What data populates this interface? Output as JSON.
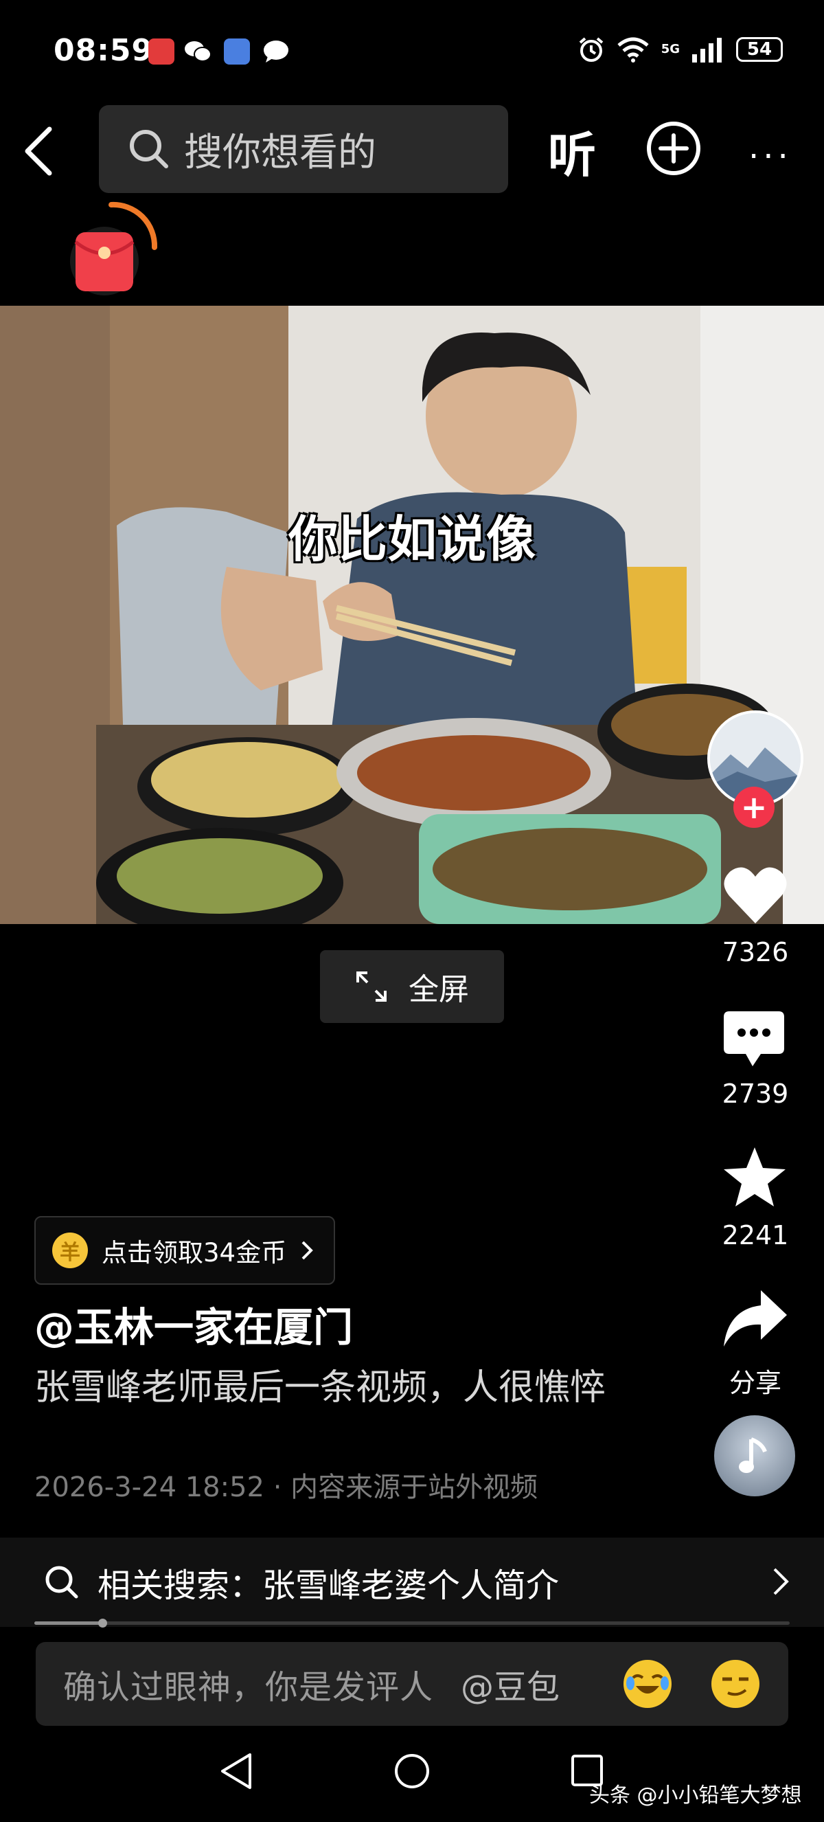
{
  "status_bar": {
    "time": "08:59",
    "network": "5G",
    "battery": "54"
  },
  "top_bar": {
    "search_placeholder": "搜你想看的",
    "listen_label": "听",
    "more_label": "···"
  },
  "video": {
    "subtitle": "你比如说像",
    "fullscreen_label": "全屏"
  },
  "side_actions": {
    "like_count": "7326",
    "comment_count": "2739",
    "favorite_count": "2241",
    "share_label": "分享"
  },
  "info": {
    "coin_label": "点击领取34金币",
    "coin_icon_char": "羊",
    "author": "@玉林一家在厦门",
    "caption": "张雪峰老师最后一条视频，人很憔悴",
    "meta": "2026-3-24 18:52 · 内容来源于站外视频"
  },
  "related_search": {
    "text": "相关搜索：张雪峰老婆个人简介"
  },
  "progress": {
    "played_fraction": 0.09
  },
  "comment_bar": {
    "placeholder": "确认过眼神，你是发评人",
    "mention": "@豆包"
  },
  "watermark": "头条 @小小铅笔大梦想",
  "colors": {
    "background": "#000000",
    "accent_red": "#f2344a",
    "redpacket_orange": "#f07a28",
    "coin_gold": "#f6c53a"
  },
  "icons": [
    "back-icon",
    "search-icon",
    "plus-circle-icon",
    "redpacket-icon",
    "expand-icon",
    "heart-icon",
    "comment-icon",
    "star-icon",
    "share-icon",
    "music-note-icon",
    "chevron-right-icon",
    "nav-back-icon",
    "nav-home-icon",
    "nav-recents-icon"
  ]
}
